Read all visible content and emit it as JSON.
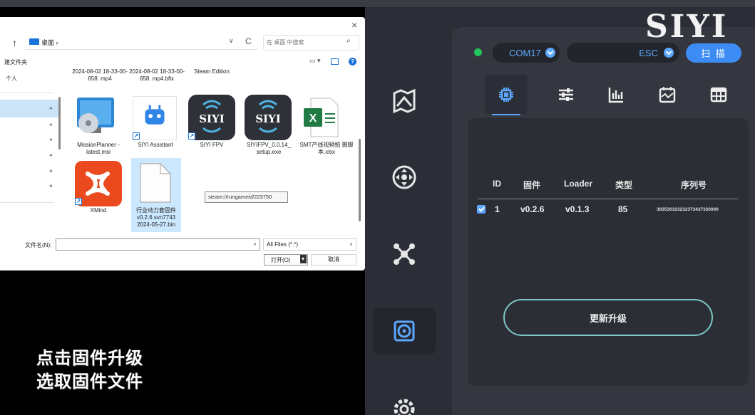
{
  "dialog": {
    "close": "×",
    "nav_back": "↑",
    "address_path": "桌面 ›",
    "address_chevron": "∨",
    "refresh": "C",
    "search_placeholder": "在 桌面 中搜索",
    "new_folder": "建文件夹",
    "sidebar_personal": "个人",
    "files": [
      {
        "name": "2024-08-02 18-33-00-658. mp4",
        "type": "video",
        "selected": false
      },
      {
        "name": "2024-08-02 18-33-00-658. mp4.bfix",
        "type": "file",
        "selected": false
      },
      {
        "name": "Steam Edition",
        "type": "app",
        "selected": false
      },
      {
        "name": "MissionPlanner -latest.msi",
        "type": "msi",
        "selected": false
      },
      {
        "name": "SIYI Assistant",
        "type": "shortcut",
        "selected": false
      },
      {
        "name": "SIYI FPV",
        "type": "shortcut",
        "selected": false
      },
      {
        "name": "SIYIFPV_0.0.14_ setup.exe",
        "type": "exe",
        "selected": false
      },
      {
        "name": "SMT产线视频拍 摄脚本.xlsx",
        "type": "xlsx",
        "selected": false
      },
      {
        "name": "XMind",
        "type": "shortcut",
        "selected": false
      },
      {
        "name": "行业动力套固件 v0.2.6 svn7743 2024-05-27.bin",
        "type": "bin",
        "selected": true
      }
    ],
    "siyi_logo_text": "SIYI",
    "tooltip": "steam://rungameid/223750",
    "filename_label": "文件名(N):",
    "filename_value": "",
    "filetype_value": "All Files (*.*)",
    "open_label": "打开(O)",
    "cancel_label": "取消"
  },
  "caption": {
    "line1": "点击固件升级",
    "line2": "选取固件文件"
  },
  "app": {
    "brand": "SIYI",
    "status_color": "#22c55e",
    "port": "COM17",
    "device": "ESC",
    "scan_label": "扫 描",
    "nav_items": [
      {
        "icon": "map-icon"
      },
      {
        "icon": "joystick-icon"
      },
      {
        "icon": "drone-icon"
      },
      {
        "icon": "firmware-icon"
      },
      {
        "icon": "settings-icon"
      }
    ],
    "tabs": [
      {
        "icon": "chip-icon",
        "active": true
      },
      {
        "icon": "sliders-icon",
        "active": false
      },
      {
        "icon": "bar-chart-icon",
        "active": false
      },
      {
        "icon": "calendar-chart-icon",
        "active": false
      },
      {
        "icon": "table-icon",
        "active": false
      }
    ],
    "table": {
      "headers": [
        "ID",
        "固件",
        "Loader",
        "类型",
        "序列号"
      ],
      "rows": [
        {
          "checked": true,
          "id": "1",
          "firmware": "v0.2.6",
          "loader": "v0.1.3",
          "type": "85",
          "serial": "383530323232373437330000"
        }
      ]
    },
    "update_label": "更新升级",
    "accent_color": "#5ea7ff"
  }
}
